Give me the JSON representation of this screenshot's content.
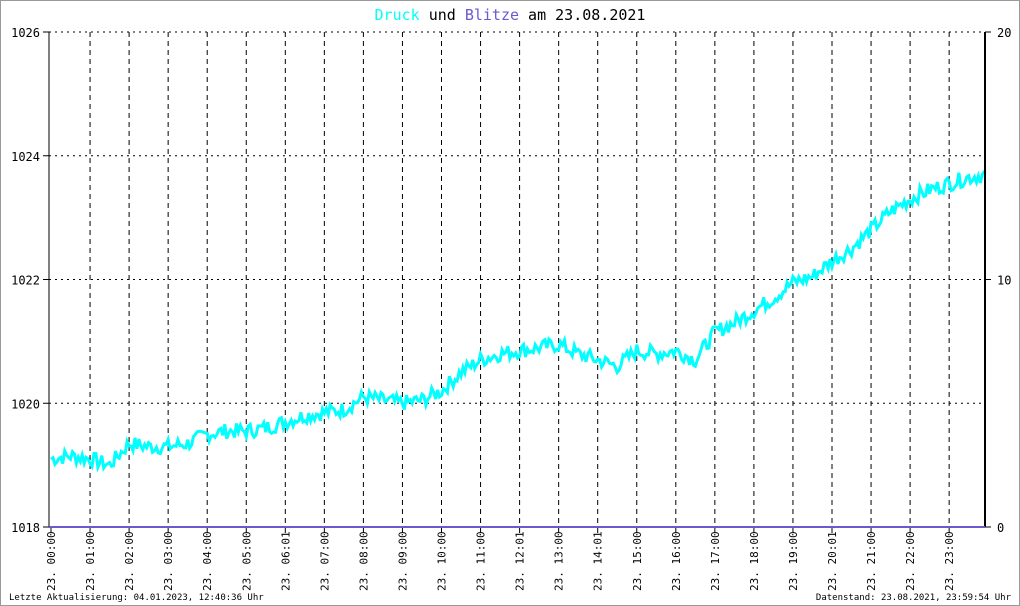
{
  "title": {
    "part1": "Druck",
    "part2": " und ",
    "part3": "Blitze",
    "part4": " am 23.08.2021"
  },
  "footer": {
    "left": "Letzte Aktualisierung: 04.01.2023, 12:40:36 Uhr",
    "right": "Datenstand: 23.08.2021, 23:59:54 Uhr"
  },
  "colors": {
    "pressure": "#00ffff",
    "lightning": "#6a5acd",
    "grid": "#000000"
  },
  "chart_data": {
    "type": "line",
    "title": "Druck und Blitze am 23.08.2021",
    "ylim_left": [
      1018,
      1026
    ],
    "ylim_right": [
      0,
      20
    ],
    "yticks_left": [
      "1018",
      "1020",
      "1022",
      "1024",
      "1026"
    ],
    "yticks_right": [
      "0",
      "10",
      "20"
    ],
    "xticks": [
      "23. 00:00",
      "23. 01:00",
      "23. 02:00",
      "23. 03:00",
      "23. 04:00",
      "23. 05:00",
      "23. 06:01",
      "23. 07:00",
      "23. 08:00",
      "23. 09:00",
      "23. 10:00",
      "23. 11:00",
      "23. 12:01",
      "23. 13:00",
      "23. 14:01",
      "23. 15:00",
      "23. 16:00",
      "23. 17:00",
      "23. 18:00",
      "23. 19:00",
      "23. 20:01",
      "23. 21:00",
      "23. 22:00",
      "23. 23:00"
    ],
    "grid": true,
    "series": [
      {
        "name": "Druck",
        "x_hours": [
          0,
          0.5,
          1,
          1.5,
          2,
          2.5,
          3,
          3.5,
          4,
          4.5,
          5,
          5.5,
          6,
          6.5,
          7,
          7.5,
          8,
          8.5,
          9,
          9.5,
          10,
          10.5,
          11,
          11.5,
          12,
          12.5,
          13,
          13.5,
          14,
          14.5,
          15,
          15.5,
          16,
          16.5,
          17,
          17.5,
          18,
          18.5,
          19,
          19.5,
          20,
          20.5,
          21,
          21.5,
          22,
          22.5,
          23,
          23.5,
          24
        ],
        "values": [
          1019.1,
          1019.15,
          1019.1,
          1019.0,
          1019.35,
          1019.3,
          1019.3,
          1019.35,
          1019.5,
          1019.55,
          1019.55,
          1019.6,
          1019.7,
          1019.8,
          1019.85,
          1019.9,
          1020.1,
          1020.05,
          1020.0,
          1020.05,
          1020.2,
          1020.5,
          1020.7,
          1020.8,
          1020.85,
          1020.9,
          1020.95,
          1020.8,
          1020.7,
          1020.6,
          1020.85,
          1020.8,
          1020.85,
          1020.7,
          1021.15,
          1021.3,
          1021.5,
          1021.7,
          1021.95,
          1022.05,
          1022.3,
          1022.5,
          1022.8,
          1023.1,
          1023.3,
          1023.45,
          1023.55,
          1023.65,
          1023.7
        ]
      },
      {
        "name": "Blitze",
        "x_hours": [],
        "values": []
      }
    ]
  }
}
